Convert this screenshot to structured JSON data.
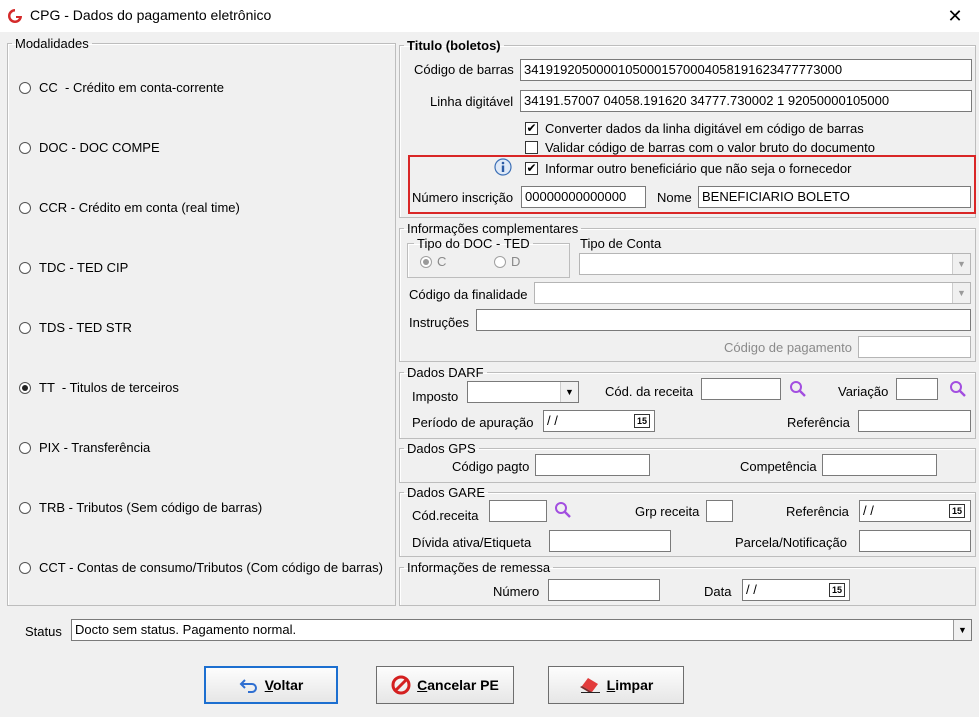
{
  "window": {
    "title": "CPG - Dados do pagamento eletrônico",
    "close": "✕"
  },
  "modalidades": {
    "legend": "Modalidades",
    "items": [
      {
        "label": "CC  - Crédito em conta-corrente",
        "checked": false
      },
      {
        "label": "DOC - DOC COMPE",
        "checked": false
      },
      {
        "label": "CCR - Crédito em conta (real time)",
        "checked": false
      },
      {
        "label": "TDC - TED CIP",
        "checked": false
      },
      {
        "label": "TDS - TED STR",
        "checked": false
      },
      {
        "label": "TT  - Titulos de terceiros",
        "checked": true
      },
      {
        "label": "PIX - Transferência",
        "checked": false
      },
      {
        "label": "TRB - Tributos (Sem código de barras)",
        "checked": false
      },
      {
        "label": "CCT - Contas de consumo/Tributos (Com código de barras)",
        "checked": false
      }
    ]
  },
  "titulo": {
    "legend": "Titulo (boletos)",
    "codigo_barras_label": "Código de barras",
    "codigo_barras": "34191920500001050001570004058191623477773000",
    "linha_digitavel_label": "Linha digitável",
    "linha_digitavel": "34191.57007 04058.191620 34777.730002 1 92050000105000",
    "converter_label": "Converter dados da linha digitável em código de barras",
    "converter_checked": true,
    "validar_label": "Validar código de barras com o valor bruto do documento",
    "validar_checked": false,
    "informar_label": "Informar outro beneficiário que não seja o fornecedor",
    "informar_checked": true,
    "numero_inscricao_label": "Número inscrição",
    "numero_inscricao": "00000000000000",
    "nome_label": "Nome",
    "nome": "BENEFICIARIO BOLETO"
  },
  "complementares": {
    "legend": "Informações complementares",
    "tipo_doc_legend": "Tipo do DOC - TED",
    "tipo_doc_options": [
      "C",
      "D"
    ],
    "tipo_conta_label": "Tipo de Conta",
    "codigo_finalidade_label": "Código da finalidade",
    "instrucoes_label": "Instruções",
    "codigo_pagamento_label": "Código de pagamento"
  },
  "darf": {
    "legend": "Dados DARF",
    "imposto_label": "Imposto",
    "cod_receita_label": "Cód. da receita",
    "variacao_label": "Variação",
    "periodo_label": "Período de apuração",
    "periodo_value": " / /",
    "referencia_label": "Referência"
  },
  "gps": {
    "legend": "Dados GPS",
    "codigo_pagto_label": "Código pagto",
    "competencia_label": "Competência"
  },
  "gare": {
    "legend": "Dados GARE",
    "cod_receita_label": "Cód.receita",
    "grp_receita_label": "Grp receita",
    "referencia_label": "Referência",
    "referencia_value": " / /",
    "divida_label": "Dívida ativa/Etiqueta",
    "parcela_label": "Parcela/Notificação"
  },
  "remessa": {
    "legend": "Informações de remessa",
    "numero_label": "Número",
    "data_label": "Data",
    "data_value": " / /"
  },
  "status": {
    "label": "Status",
    "value": "Docto sem status. Pagamento normal."
  },
  "buttons": {
    "voltar": "Voltar",
    "cancelar": "Cancelar PE",
    "limpar": "Limpar"
  },
  "calendar_icon_text": "15"
}
